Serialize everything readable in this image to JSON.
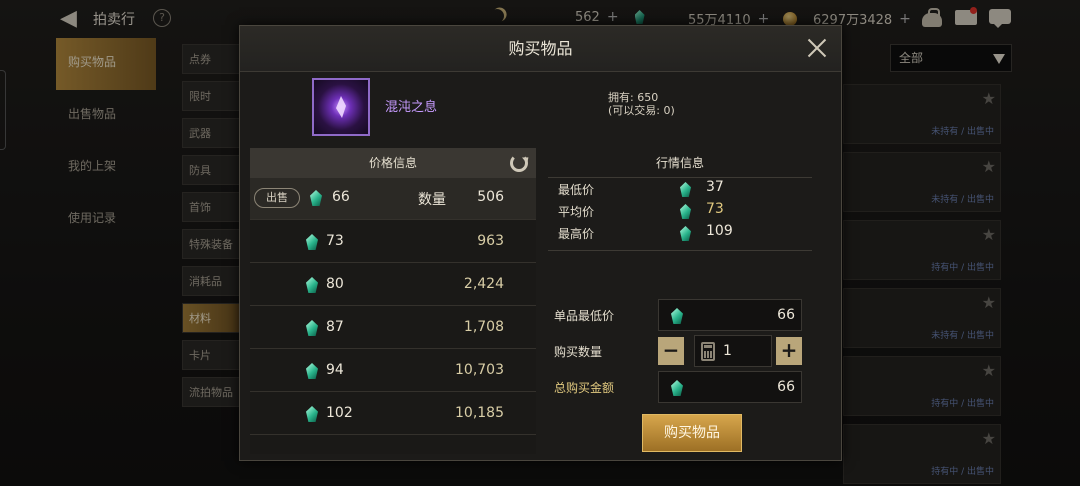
{
  "topbar": {
    "title": "拍卖行",
    "currency_1": "562",
    "currency_2": "55万4110",
    "currency_3": "6297万3428"
  },
  "left_nav": {
    "items": [
      {
        "label": "购买物品",
        "active": true
      },
      {
        "label": "出售物品",
        "active": false
      },
      {
        "label": "我的上架",
        "active": false
      },
      {
        "label": "使用记录",
        "active": false
      }
    ]
  },
  "categories": {
    "items": [
      {
        "label": "点券",
        "active": false
      },
      {
        "label": "限时",
        "active": false
      },
      {
        "label": "武器",
        "active": false
      },
      {
        "label": "防具",
        "active": false
      },
      {
        "label": "首饰",
        "active": false
      },
      {
        "label": "特殊装备",
        "active": false
      },
      {
        "label": "消耗品",
        "active": false
      },
      {
        "label": "材料",
        "active": true
      },
      {
        "label": "卡片",
        "active": false
      },
      {
        "label": "流拍物品",
        "active": false
      }
    ]
  },
  "filter": {
    "selected": "全部"
  },
  "modal": {
    "title": "购买物品",
    "item": {
      "name": "混沌之息",
      "owned_line": "拥有: 650",
      "tradable_line": "(可以交易: 0)"
    },
    "price_panel": {
      "title": "价格信息",
      "sell_tag": "出售",
      "qty_label": "数量",
      "rows": [
        {
          "price": "66",
          "qty": "506"
        },
        {
          "price": "73",
          "qty": "963"
        },
        {
          "price": "80",
          "qty": "2,424"
        },
        {
          "price": "87",
          "qty": "1,708"
        },
        {
          "price": "94",
          "qty": "10,703"
        },
        {
          "price": "102",
          "qty": "10,185"
        }
      ]
    },
    "market_panel": {
      "title": "行情信息",
      "min_label": "最低价",
      "min_value": "37",
      "avg_label": "平均价",
      "avg_value": "73",
      "max_label": "最高价",
      "max_value": "109"
    },
    "form": {
      "unit_price_label": "单品最低价",
      "unit_price_value": "66",
      "quantity_label": "购买数量",
      "quantity_value": "1",
      "total_label": "总购买金额",
      "total_value": "66",
      "minus": "−",
      "plus": "+"
    },
    "buy_button": "购买物品"
  },
  "background_cards": {
    "status_1": "未持有 / 出售中",
    "status_2": "持有中 / 出售中"
  },
  "colors": {
    "accent_gold": "#b48a3e",
    "item_purple": "#c79bff",
    "avg_gold": "#e1c97f"
  }
}
